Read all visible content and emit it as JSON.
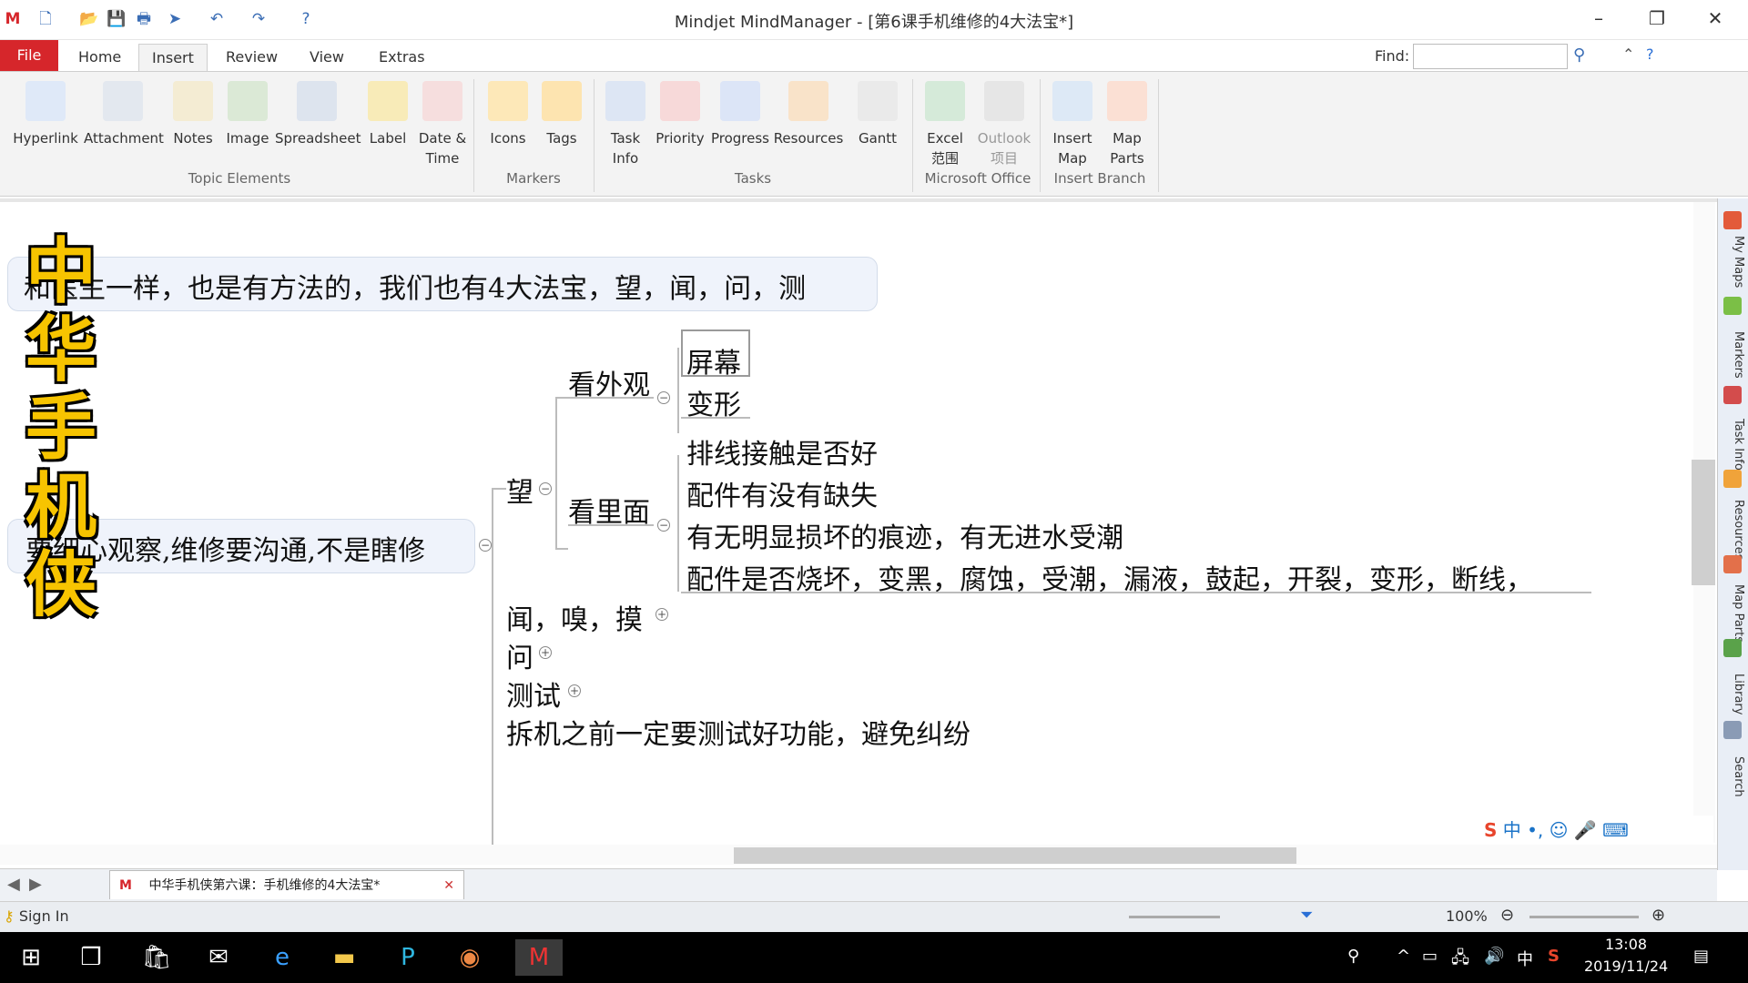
{
  "window": {
    "title": "Mindjet MindManager - [第6课手机维修的4大法宝*]",
    "minimize": "–",
    "restore": "❐",
    "close": "✕"
  },
  "quick_access": {
    "icons": [
      "mindmanager-logo-icon",
      "new-file-icon",
      "open-file-icon",
      "save-icon",
      "print-icon",
      "send-icon",
      "undo-icon",
      "redo-icon",
      "help-icon"
    ]
  },
  "tabs": {
    "file": "File",
    "home": "Home",
    "insert": "Insert",
    "review": "Review",
    "view": "View",
    "extras": "Extras"
  },
  "find": {
    "label": "Find:",
    "value": ""
  },
  "ribbon": {
    "buttons": {
      "hyperlink": "Hyperlink",
      "attachment": "Attachment",
      "notes": "Notes",
      "image": "Image",
      "spreadsheet": "Spreadsheet",
      "label": "Label",
      "datetime": "Date &\nTime",
      "icons": "Icons",
      "tags": "Tags",
      "taskinfo": "Task\nInfo",
      "priority": "Priority",
      "progress": "Progress",
      "resources": "Resources",
      "gantt": "Gantt",
      "excel": "Excel\n范围",
      "outlook": "Outlook\n项目",
      "insertmap": "Insert\nMap",
      "mapparts": "Map\nParts"
    },
    "groups": {
      "topic_elements": "Topic Elements",
      "markers": "Markers",
      "tasks": "Tasks",
      "microsoft_office": "Microsoft Office",
      "insert_branch": "Insert Branch"
    }
  },
  "map": {
    "calligraphy": [
      "中",
      "华",
      "手",
      "机",
      "侠"
    ],
    "top_topic": "和医生一样，也是有方法的，我们也有4大法宝，望，闻，问，测",
    "central_topic": "要细心观察,维修要沟通,不是瞎修",
    "wang": "望",
    "kan_waiguan": "看外观",
    "pingmu": "屏幕",
    "bianxing": "变形",
    "kan_limian": "看里面",
    "limian_items": [
      "排线接触是否好",
      "配件有没有缺失",
      "有无明显损坏的痕迹，有无进水受潮",
      "配件是否烧坏，变黑，腐蚀，受潮，漏液，鼓起，开裂，变形，断线，"
    ],
    "wen_xiu_mo": "闻，嗅，摸",
    "wen": "问",
    "ceshi": "测试",
    "last": "拆机之前一定要测试好功能，避免纠纷"
  },
  "right_panel": [
    "My Maps",
    "Markers",
    "Task Info",
    "Resources",
    "Map Parts",
    "Library",
    "Search"
  ],
  "doc_tab": {
    "title": "中华手机侠第六课：手机维修的4大法宝*"
  },
  "status": {
    "signin": "Sign In",
    "zoom": "100%"
  },
  "taskbar": {
    "time": "13:08",
    "date": "2019/11/24",
    "ime": "中"
  },
  "colors": {
    "file_tab": "#d6262b",
    "calligraphy": "#f7c400",
    "root_fill": "#eff3fb",
    "taskbar": "#000000"
  }
}
